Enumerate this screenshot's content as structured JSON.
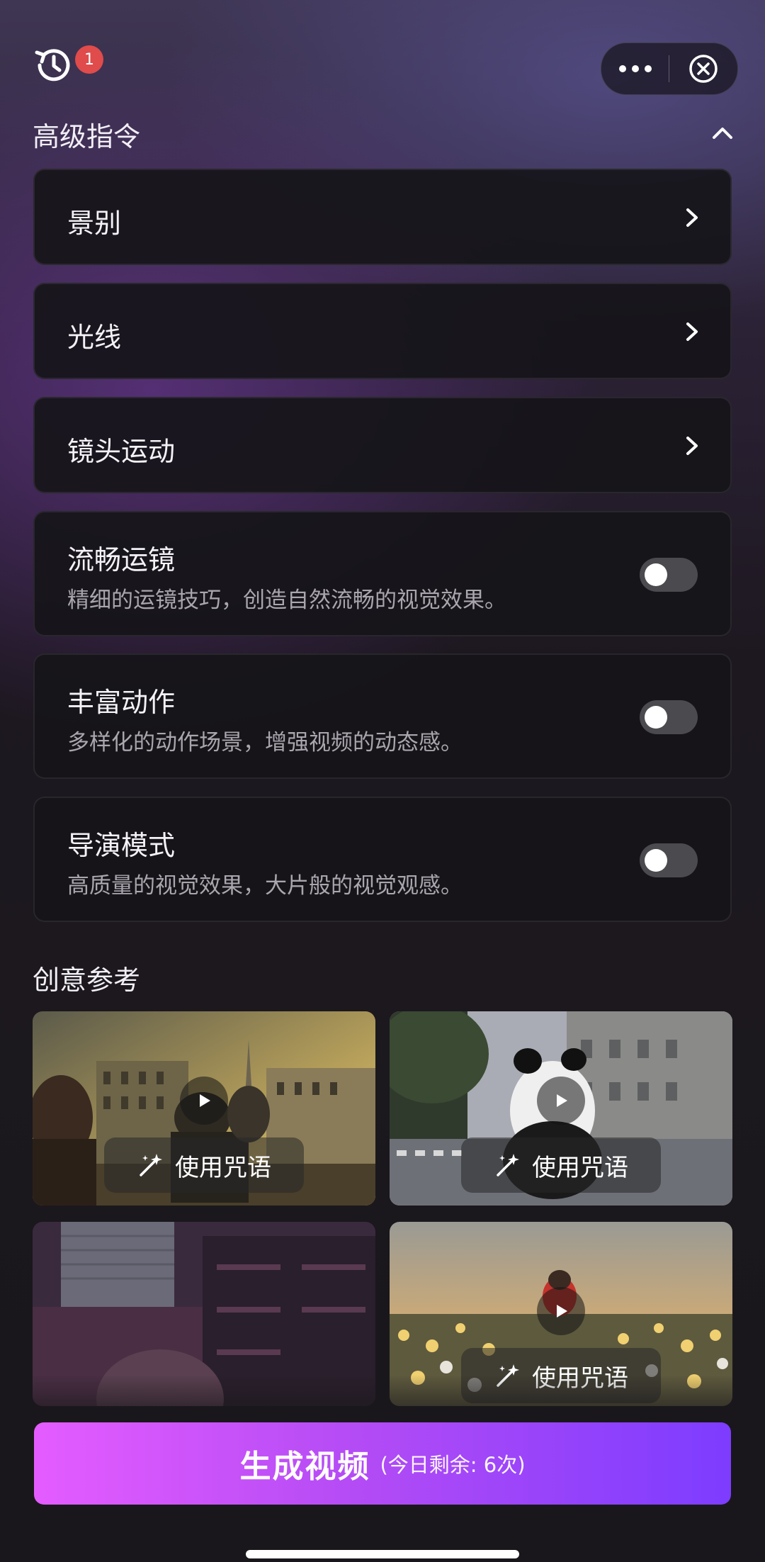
{
  "header": {
    "history_badge": "1"
  },
  "advanced": {
    "title": "高级指令",
    "nav_rows": [
      {
        "label": "景别"
      },
      {
        "label": "光线"
      },
      {
        "label": "镜头运动"
      }
    ],
    "toggle_rows": [
      {
        "label": "流畅运镜",
        "desc": "精细的运镜技巧，创造自然流畅的视觉效果。",
        "on": false
      },
      {
        "label": "丰富动作",
        "desc": "多样化的动作场景，增强视频的动态感。",
        "on": false
      },
      {
        "label": "导演模式",
        "desc": "高质量的视觉效果，大片般的视觉观感。",
        "on": false
      }
    ]
  },
  "creative": {
    "title": "创意参考",
    "cards": [
      {
        "button": "使用咒语",
        "scene": "paris-cafe"
      },
      {
        "button": "使用咒语",
        "scene": "panda-street"
      },
      {
        "button": "",
        "scene": "toy-room"
      },
      {
        "button": "使用咒语",
        "scene": "flower-field"
      }
    ]
  },
  "generate": {
    "label": "生成视频",
    "remaining": "(今日剩余: 6次)"
  },
  "colors": {
    "accent_start": "#e45cff",
    "accent_end": "#7d3cff",
    "badge": "#e04b4b"
  }
}
